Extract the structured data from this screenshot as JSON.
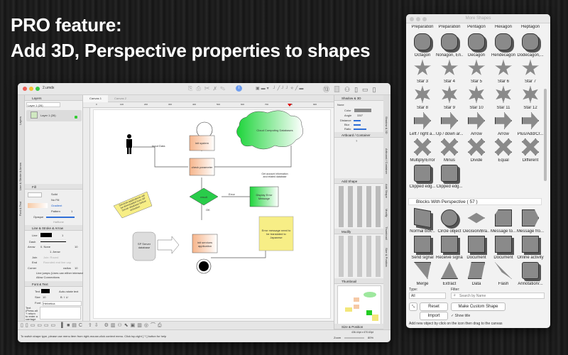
{
  "headline": {
    "line1": "PRO feature:",
    "line2": "Add 3D, Perspective properties to shapes"
  },
  "app": {
    "title": "2.umdx",
    "tabs": [
      "Canvas 1",
      "Canvas 2"
    ],
    "layers": {
      "header": "Layers",
      "layer_select": "Layer 1 (26)",
      "layer_item": "Layer 1 (26)"
    },
    "side_tabs": [
      "Layers",
      "Line & Stroke & Arrow",
      "Font & Text"
    ],
    "fill": {
      "header": "Fill",
      "options": [
        "Solid",
        "No Fill",
        "Gradient",
        "Pattern"
      ],
      "pattern_value": "1",
      "opaque_label": "Opaque",
      "halftone_label": "Halftone"
    },
    "line": {
      "header": "Line & Stroke & Arrow",
      "line_label": "Line",
      "line_width": "1",
      "dash_label": "Dash",
      "arrow_label": "Arrow",
      "arrow_value": "0. None",
      "arrow_value2": "1. Arrow",
      "arrow_size": "10",
      "join_label": "Join",
      "join_value": "Join: Round",
      "end_label": "End",
      "end_value": "Rounded end line cap",
      "corner_label": "Corner",
      "radius_label": "radius",
      "radius_value": "10",
      "line_jumps": "Line jumps (Lines can either intersect)",
      "allow_connections": "Allow Connections"
    },
    "font": {
      "header": "Font & Text",
      "text_label": "Text",
      "auto_rotate": "Auto-rotate text",
      "size_label": "Size",
      "size_value": "10",
      "font_label": "Font",
      "font_value": "Helvetica",
      "text_hint": "Text (Press alt + return to enter a carriage return)",
      "align_label": "Align",
      "wrap_label": "Wrap"
    },
    "shadow": {
      "header": "Shadow & 3D",
      "none_label": "None",
      "color_label": "Color",
      "angle_label": "Angle",
      "angle_value": "330°",
      "distance_label": "Distance",
      "blur_label": "Blur",
      "ratio_label": "Ratio"
    },
    "artboard": {
      "header": "Artboard / Container",
      "help": "?"
    },
    "add_shape": {
      "header": "Add Shape"
    },
    "modify": {
      "header": "Modify"
    },
    "thumbnail": {
      "header": "Thumbnail"
    },
    "size_position": {
      "header": "Size & Position"
    },
    "right_tabs": [
      "Shadow & 3D",
      "Artboard / Container",
      "Add Shape",
      "Modify",
      "Thumbnail",
      "Size & Position"
    ],
    "ruler_ticks": [
      "0",
      "100",
      "200",
      "300",
      "400",
      "500",
      "600",
      "700",
      "800",
      "900"
    ],
    "status": "To switch shape type, please use menu item from right-mouse-click context menu. Click top-right [ ? ] button for help",
    "zoom_label": "Zoom",
    "zoom_value": "80%",
    "coords": "436.44pt x 670.63pt",
    "diagram": {
      "input_data": "Input Data",
      "init_system": "init system",
      "check_parameter": "check parameter",
      "cloud": "Cloud Computing Databases",
      "get_account": "Get account information and related database",
      "result": "result",
      "error": "Error",
      "ok": "OK",
      "display_error": "Display Error Message",
      "note1": "Services applications will be downloaded from SP Server database before activation",
      "sp_server": "SP Server database",
      "init_services": "init services application",
      "note2": "Error message need to be translated to Japanese"
    }
  },
  "more_shapes": {
    "title": "More Shapes",
    "top_row": [
      "Preparation",
      "Preparation",
      "Pentagon",
      "Hexagon",
      "Heptagon"
    ],
    "rows": [
      [
        "Octagon",
        "Nonagon, En...",
        "Decagon",
        "Hendecagon",
        "Dodecagon,..."
      ],
      [
        "Star 3",
        "Star 4",
        "Star 5",
        "Star 6",
        "Star 7"
      ],
      [
        "Star 8",
        "Star 9",
        "Star 10",
        "Star 11",
        "Star 12"
      ],
      [
        "Left / right a...",
        "Up / down ar...",
        "Arrow",
        "Arrow",
        "Plus/Add/Cr..."
      ],
      [
        "Multiply/Error",
        "Minus",
        "Divide",
        "Equal",
        "Different"
      ],
      [
        "Clipped edg...",
        "Clipped edg..."
      ]
    ],
    "section": "Blocks With Perspective ( 57 )",
    "rows2": [
      [
        "Normal box...",
        "Circle object",
        "Decision/Bra...",
        "Message to...",
        "Message fro..."
      ],
      [
        "Send signal",
        "Receive signal",
        "Document",
        "Document",
        "Online activity"
      ],
      [
        "Merge",
        "Extract",
        "Data",
        "Flash",
        "Annotation/..."
      ]
    ],
    "type_label": "Type:",
    "type_value": "All",
    "filter_label": "Filter:",
    "search_placeholder": "Search by Name",
    "reset": "Reset",
    "make_custom": "Make Custom Shape",
    "import": "Import",
    "show_title": "Show title",
    "hint": "Add new object by click on the icon then drag to the canvas"
  }
}
